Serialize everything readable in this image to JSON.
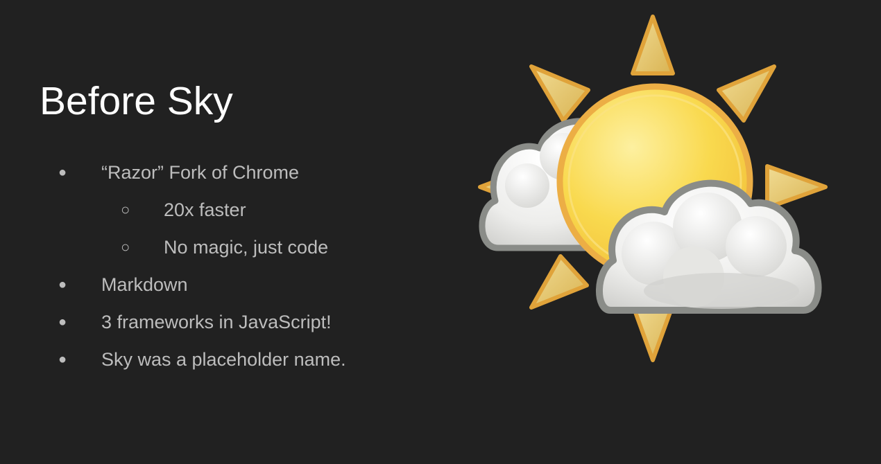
{
  "slide": {
    "title": "Before Sky",
    "bullets": [
      {
        "marker": "●",
        "text": "“Razor” Fork of Chrome"
      },
      {
        "marker": "○",
        "text": "20x faster"
      },
      {
        "marker": "○",
        "text": "No magic, just code"
      },
      {
        "marker": "●",
        "text": "Markdown"
      },
      {
        "marker": "●",
        "text": "3 frameworks in JavaScript!"
      },
      {
        "marker": "●",
        "text": "Sky was a placeholder name."
      }
    ]
  },
  "art": {
    "icon": "partly-cloudy-sun-icon"
  },
  "colors": {
    "background": "#212121",
    "title": "#ffffff",
    "body_text": "#bdbdbd",
    "sun_core": "#f9d94e",
    "sun_ray": "#e2a53a",
    "cloud": "#eeeeee",
    "cloud_outline": "#8a8c88"
  }
}
